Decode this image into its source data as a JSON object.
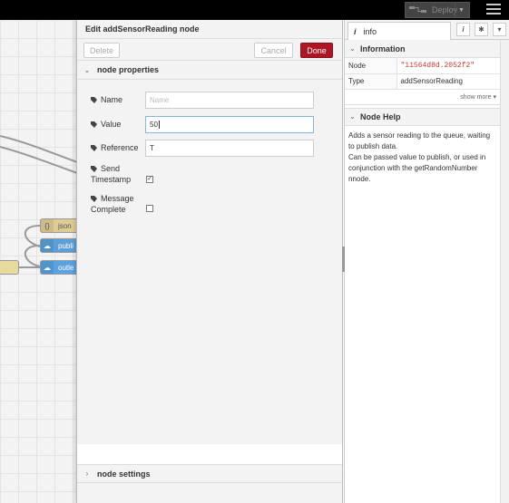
{
  "header": {
    "deploy_label": "Deploy"
  },
  "canvas": {
    "nodes": [
      {
        "label": "json"
      },
      {
        "label": "publi"
      },
      {
        "label": "outle"
      }
    ]
  },
  "tray": {
    "title": "Edit addSensorReading node",
    "delete_label": "Delete",
    "cancel_label": "Cancel",
    "done_label": "Done",
    "properties_heading": "node properties",
    "settings_heading": "node settings",
    "fields": {
      "name_label": "Name",
      "name_placeholder": "Name",
      "value_label": "Value",
      "value_value": "50",
      "reference_label": "Reference",
      "reference_value": "T",
      "send_timestamp_label_1": "Send",
      "send_timestamp_label_2": "Timestamp",
      "send_timestamp_checked": true,
      "message_complete_label_1": "Message",
      "message_complete_label_2": "Complete",
      "message_complete_checked": false
    }
  },
  "sidebar": {
    "tab_label": "info",
    "tab_icon": "info-icon",
    "information_heading": "Information",
    "info_rows": [
      {
        "key": "Node",
        "value": "\"11564d8d.2052f2\""
      },
      {
        "key": "Type",
        "value": "addSensorReading"
      }
    ],
    "show_more": "show more ▾",
    "help_heading": "Node Help",
    "help_lines": [
      "Adds a sensor reading to the queue, waiting",
      "to publish data.",
      "Can be passed value to publish, or used in",
      "conjunction with the getRandomNumber",
      "nnode."
    ]
  },
  "colors": {
    "done_button": "#ad1625",
    "json_node": "#dfcb95",
    "publish_node": "#5b9fd6",
    "outlet_node": "#5aa2e0",
    "yellow_node": "#e6db9c"
  }
}
